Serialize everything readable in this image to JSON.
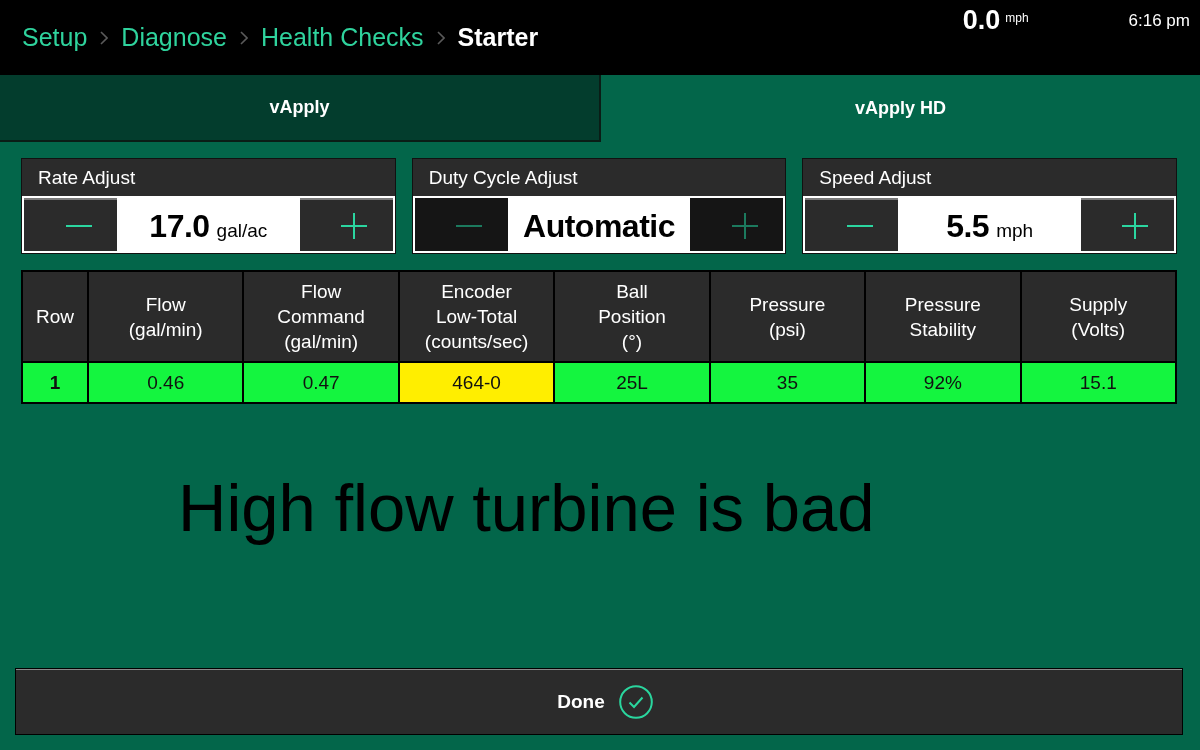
{
  "status_bar": {
    "breadcrumbs": [
      {
        "label": "Setup",
        "current": false
      },
      {
        "label": "Diagnose",
        "current": false
      },
      {
        "label": "Health Checks",
        "current": false
      },
      {
        "label": "Starter",
        "current": true
      }
    ],
    "speed": "0.0",
    "speed_unit": "mph",
    "time": "6:16 pm"
  },
  "tabs": [
    {
      "label": "vApply",
      "selected": false
    },
    {
      "label": "vApply HD",
      "selected": true
    }
  ],
  "adjusters": [
    {
      "label": "Rate Adjust",
      "value": "17.0",
      "unit": "gal/ac",
      "disabled": false
    },
    {
      "label": "Duty Cycle Adjust",
      "value": "Automatic",
      "disabled": true
    },
    {
      "label": "Speed Adjust",
      "value": "5.5",
      "unit": "mph",
      "disabled": false
    }
  ],
  "table": {
    "columns": [
      "Row",
      "Flow\n(gal/min)",
      "Flow\nCommand\n(gal/min)",
      "Encoder\nLow-Total\n(counts/sec)",
      "Ball\nPosition\n(°)",
      "Pressure\n(psi)",
      "Pressure\nStability",
      "Supply\n(Volts)"
    ],
    "rows": [
      {
        "cells": [
          {
            "value": "1",
            "color": "#14f53f"
          },
          {
            "value": "0.46",
            "color": "#14f53f"
          },
          {
            "value": "0.47",
            "color": "#14f53f"
          },
          {
            "value": "464-0",
            "color": "#ffee00"
          },
          {
            "value": "25L",
            "color": "#14f53f"
          },
          {
            "value": "35",
            "color": "#14f53f"
          },
          {
            "value": "92%",
            "color": "#14f53f"
          },
          {
            "value": "15.1",
            "color": "#14f53f"
          }
        ]
      }
    ]
  },
  "note": "High flow turbine is bad",
  "done_button": {
    "label": "Done"
  }
}
